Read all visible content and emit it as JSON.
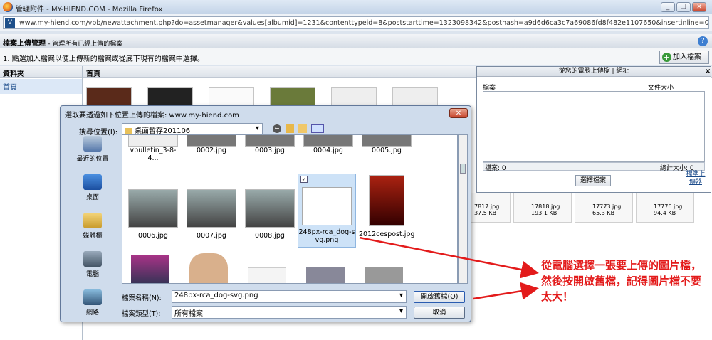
{
  "window": {
    "title": "管理附件 - MY-HIEND.COM - Mozilla Firefox"
  },
  "url": "www.my-hiend.com/vbb/newattachment.php?do=assetmanager&values[albumid]=1231&contenttypeid=8&poststarttime=1323098342&posthash=a9d6d6ca3c7a69086fd8f482e1107650&insertinline=0",
  "header": {
    "title": "檔案上傳管理",
    "subtitle": "- 管理所有已經上傳的檔案"
  },
  "instructions": "1. 點選加入檔案以便上傳新的檔案或從底下現有的檔案中選擇。",
  "add_button": "加入檔案",
  "left_pane": {
    "heading": "資料夾",
    "item": "首頁"
  },
  "main_pane": {
    "heading": "首頁",
    "thumbs_row2": [
      {
        "name": "7817.jpg",
        "size": "37.5 KB"
      },
      {
        "name": "17818.jpg",
        "size": "193.1 KB"
      },
      {
        "name": "17773.jpg",
        "size": "65.3 KB"
      },
      {
        "name": "17776.jpg",
        "size": "94.4 KB"
      }
    ]
  },
  "upload_panel": {
    "title": "從您的電腦上傳檔 | 網址",
    "col_file": "檔案",
    "col_size": "文件大小",
    "count": "檔案: 0",
    "total": "總計大小: 0",
    "select_button": "選擇檔案",
    "standard_uploader": "標準上傳器"
  },
  "dialog": {
    "title": "選取要透過如下位置上傳的檔案: www.my-hiend.com",
    "lookin_label": "搜尋位置(I):",
    "lookin_value": "桌面暫存201106",
    "places": [
      "最近的位置",
      "桌面",
      "媒體櫃",
      "電腦",
      "網路"
    ],
    "files_row1": [
      "vbulletin_3-8-4...",
      "0002.jpg",
      "0003.jpg",
      "0004.jpg",
      "0005.jpg"
    ],
    "files_row2": [
      "0006.jpg",
      "0007.jpg",
      "0008.jpg",
      "248px-rca_dog-svg.png",
      "2012cespost.jpg"
    ],
    "filename_label": "檔案名稱(N):",
    "filename_value": "248px-rca_dog-svg.png",
    "filetype_label": "檔案類型(T):",
    "filetype_value": "所有檔案",
    "open_button": "開啟舊檔(O)",
    "cancel_button": "取消"
  },
  "annotation": {
    "text": "從電腦選擇一張要上傳的圖片檔，然後按開啟舊檔，記得圖片檔不要太大！",
    "color": "#e31b1b"
  }
}
